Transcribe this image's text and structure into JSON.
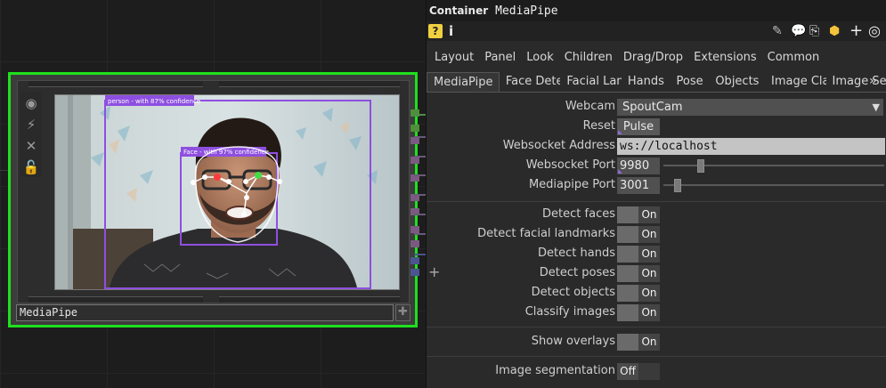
{
  "network": {
    "node": {
      "name": "MediaPipe",
      "viewer": {
        "person_label": "person - with 87% confidence",
        "face_label": "Face - with 97% confidence"
      }
    },
    "add_symbol": "+"
  },
  "panel": {
    "type_label": "Container",
    "op_name": "MediaPipe",
    "icons": [
      "help-icon",
      "info-icon",
      "pencil-icon",
      "comment-icon",
      "clone-icon",
      "python-icon",
      "add-icon",
      "target-icon"
    ],
    "tabs_row1": [
      "Layout",
      "Panel",
      "Look",
      "Children",
      "Drag/Drop",
      "Extensions",
      "Common"
    ],
    "tabs_row2": [
      "MediaPipe",
      "Face Detec",
      "Facial Lanc",
      "Hands",
      "Pose",
      "Objects",
      "Image Cla",
      "Image Seg"
    ],
    "active_tab": "MediaPipe",
    "more_tabs_glyph": "»",
    "params": {
      "webcam": {
        "label": "Webcam",
        "value": "SpoutCam"
      },
      "reset": {
        "label": "Reset",
        "value": "Pulse"
      },
      "websocket_address": {
        "label": "Websocket Address",
        "value": "ws://localhost"
      },
      "websocket_port": {
        "label": "Websocket Port",
        "value": "9980"
      },
      "mediapipe_port": {
        "label": "Mediapipe Port",
        "value": "3001"
      },
      "detect_faces": {
        "label": "Detect faces",
        "value": "On"
      },
      "detect_facial_landmarks": {
        "label": "Detect facial landmarks",
        "value": "On"
      },
      "detect_hands": {
        "label": "Detect hands",
        "value": "On"
      },
      "detect_poses": {
        "label": "Detect poses",
        "value": "On"
      },
      "detect_objects": {
        "label": "Detect objects",
        "value": "On"
      },
      "classify_images": {
        "label": "Classify images",
        "value": "On"
      },
      "show_overlays": {
        "label": "Show overlays",
        "value": "On"
      },
      "image_segmentation": {
        "label": "Image segmentation",
        "value": "Off"
      }
    }
  },
  "colors": {
    "node_border": "#1ee01e",
    "bbox_purple": "#8e4fe0",
    "accent_purple": "#8f6bd4"
  }
}
